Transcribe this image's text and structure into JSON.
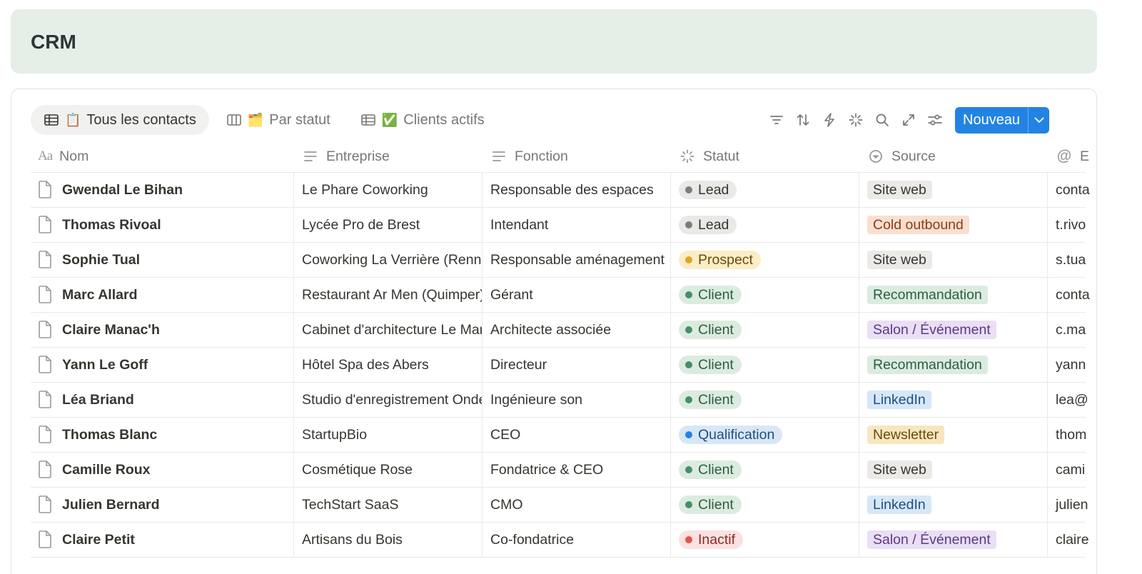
{
  "page": {
    "title": "CRM"
  },
  "views": [
    {
      "label": "Tous les contacts",
      "emoji": "📋",
      "icon": "table-icon",
      "active": true
    },
    {
      "label": "Par statut",
      "emoji": "🗂️",
      "icon": "board-icon",
      "active": false
    },
    {
      "label": "Clients actifs",
      "emoji": "✅",
      "icon": "table-icon",
      "active": false
    }
  ],
  "toolbar": {
    "icons": [
      "filter-icon",
      "sort-icon",
      "automation-icon",
      "ai-sparkle-icon",
      "search-icon",
      "expand-icon",
      "settings-sliders-icon"
    ],
    "new_label": "Nouveau"
  },
  "columns": {
    "nom": "Nom",
    "entreprise": "Entreprise",
    "fonction": "Fonction",
    "statut": "Statut",
    "source": "Source",
    "email": "E"
  },
  "status_colors": {
    "Lead": {
      "bg": "#e9e9e7",
      "dot": "#7d7c78",
      "fg": "#37352f"
    },
    "Prospect": {
      "bg": "#fbedc5",
      "dot": "#e3a423",
      "fg": "#6b4c0b"
    },
    "Client": {
      "bg": "#dcebe0",
      "dot": "#449063",
      "fg": "#2b5f3f"
    },
    "Qualification": {
      "bg": "#d8e7f7",
      "dot": "#2383e2",
      "fg": "#1d4f82"
    },
    "Inactif": {
      "bg": "#fbe1df",
      "dot": "#e5534b",
      "fg": "#8a2a24"
    }
  },
  "source_colors": {
    "Site web": {
      "bg": "#ebeae7",
      "fg": "#37352f"
    },
    "Cold outbound": {
      "bg": "#f9dfd0",
      "fg": "#8a3e14"
    },
    "Recommandation": {
      "bg": "#dcebe0",
      "fg": "#2b5f3f"
    },
    "Salon / Événement": {
      "bg": "#eadff5",
      "fg": "#5c3a86"
    },
    "LinkedIn": {
      "bg": "#d8e7f7",
      "fg": "#1d4f82"
    },
    "Newsletter": {
      "bg": "#f7e6c0",
      "fg": "#6b4c0b"
    }
  },
  "rows": [
    {
      "nom": "Gwendal Le Bihan",
      "entreprise": "Le Phare Coworking",
      "fonction": "Responsable des espaces",
      "statut": "Lead",
      "source": "Site web",
      "email": "conta"
    },
    {
      "nom": "Thomas Rivoal",
      "entreprise": "Lycée Pro de Brest",
      "fonction": "Intendant",
      "statut": "Lead",
      "source": "Cold outbound",
      "email": "t.rivo"
    },
    {
      "nom": "Sophie Tual",
      "entreprise": "Coworking La Verrière (Renne",
      "fonction": "Responsable aménagement",
      "statut": "Prospect",
      "source": "Site web",
      "email": "s.tua"
    },
    {
      "nom": "Marc Allard",
      "entreprise": "Restaurant Ar Men (Quimper)",
      "fonction": "Gérant",
      "statut": "Client",
      "source": "Recommandation",
      "email": "conta"
    },
    {
      "nom": "Claire Manac'h",
      "entreprise": "Cabinet d'architecture Le Mar",
      "fonction": "Architecte associée",
      "statut": "Client",
      "source": "Salon / Événement",
      "email": "c.ma"
    },
    {
      "nom": "Yann Le Goff",
      "entreprise": "Hôtel Spa des Abers",
      "fonction": "Directeur",
      "statut": "Client",
      "source": "Recommandation",
      "email": "yann"
    },
    {
      "nom": "Léa Briand",
      "entreprise": "Studio d'enregistrement Onde",
      "fonction": "Ingénieure son",
      "statut": "Client",
      "source": "LinkedIn",
      "email": "lea@"
    },
    {
      "nom": "Thomas Blanc",
      "entreprise": "StartupBio",
      "fonction": "CEO",
      "statut": "Qualification",
      "source": "Newsletter",
      "email": "thom"
    },
    {
      "nom": "Camille Roux",
      "entreprise": "Cosmétique Rose",
      "fonction": "Fondatrice & CEO",
      "statut": "Client",
      "source": "Site web",
      "email": "cami"
    },
    {
      "nom": "Julien Bernard",
      "entreprise": "TechStart SaaS",
      "fonction": "CMO",
      "statut": "Client",
      "source": "LinkedIn",
      "email": "julien"
    },
    {
      "nom": "Claire Petit",
      "entreprise": "Artisans du Bois",
      "fonction": "Co-fondatrice",
      "statut": "Inactif",
      "source": "Salon / Événement",
      "email": "claire"
    }
  ]
}
